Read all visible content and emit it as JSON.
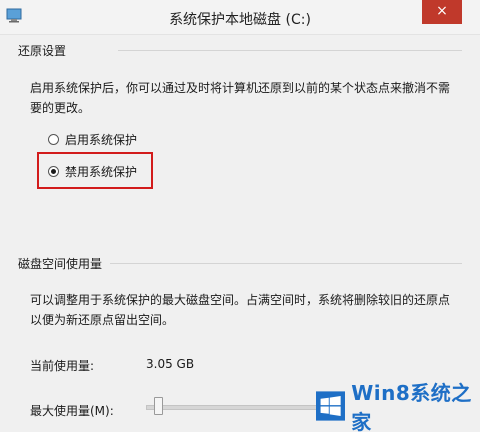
{
  "window": {
    "title": "系统保护本地磁盘 (C:)",
    "close_label": "×"
  },
  "restore_settings": {
    "heading": "还原设置",
    "description": "启用系统保护后，你可以通过及时将计算机还原到以前的某个状态点来撤消不需要的更改。",
    "options": [
      {
        "label": "启用系统保护",
        "selected": false
      },
      {
        "label": "禁用系统保护",
        "selected": true
      }
    ]
  },
  "disk_space": {
    "heading": "磁盘空间使用量",
    "description": "可以调整用于系统保护的最大磁盘空间。占满空间时，系统将删除较旧的还原点以便为新还原点留出空间。",
    "current_usage_label": "当前使用量:",
    "current_usage_value": "3.05 GB",
    "max_usage_label": "最大使用量(M):",
    "max_usage_level": 0.05
  },
  "watermark": {
    "text": "Win8系统之家"
  },
  "colors": {
    "highlight": "#d21b1b",
    "watermark_blue": "#1e6fc6",
    "close_button": "#c0392b"
  }
}
